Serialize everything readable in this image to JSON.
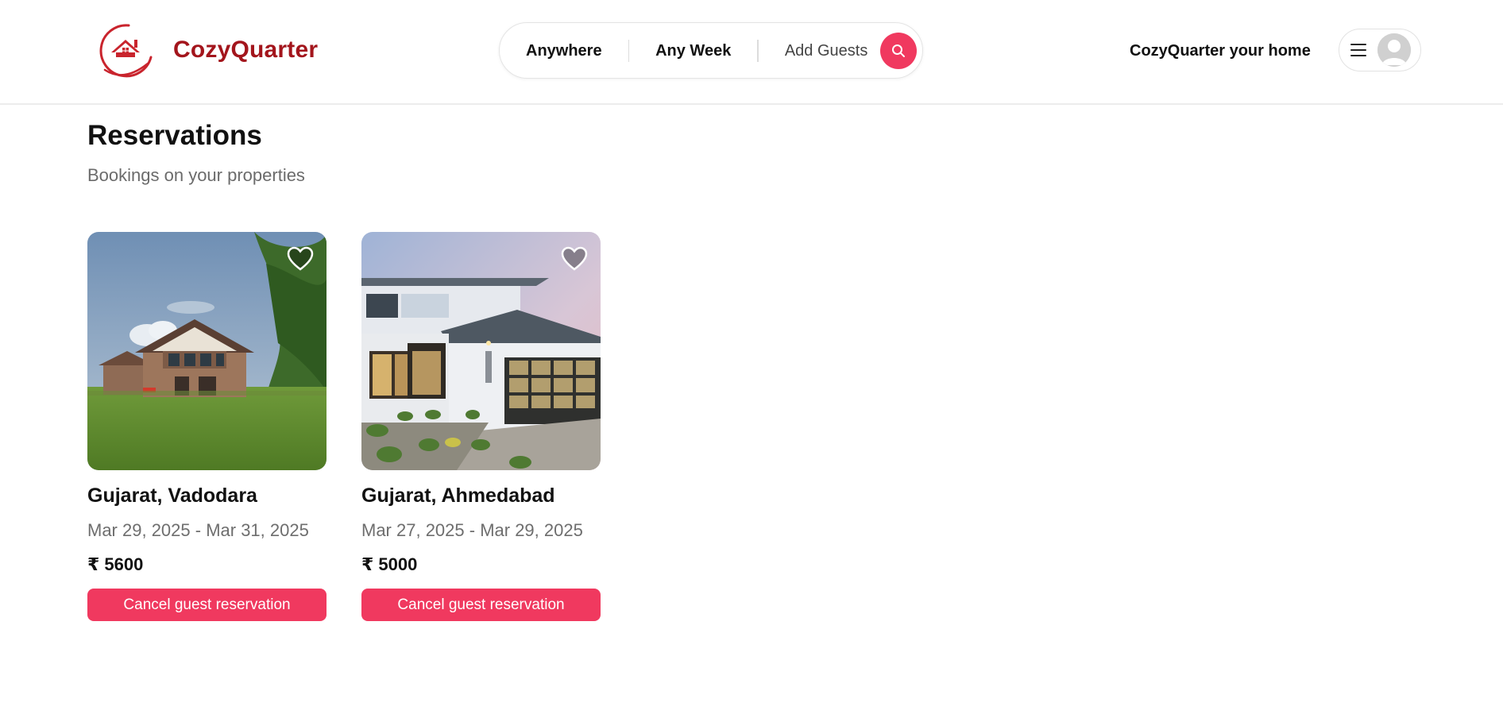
{
  "brand": {
    "name": "CozyQuarter",
    "color": "#a3151c"
  },
  "search": {
    "location_label": "Anywhere",
    "week_label": "Any Week",
    "guests_label": "Add Guests",
    "button_icon": "search-icon",
    "accent": "#f0395f"
  },
  "nav": {
    "host_link": "CozyQuarter your home",
    "menu_icon": "hamburger-icon",
    "avatar_icon": "user-avatar-icon"
  },
  "page": {
    "title": "Reservations",
    "subtitle": "Bookings on your properties"
  },
  "reservations": [
    {
      "location": "Gujarat, Vadodara",
      "dates": "Mar 29, 2025 - Mar 31, 2025",
      "price": "₹ 5600",
      "action": "Cancel guest reservation",
      "image": "country-house-photo"
    },
    {
      "location": "Gujarat, Ahmedabad",
      "dates": "Mar 27, 2025 - Mar 29, 2025",
      "price": "₹ 5000",
      "action": "Cancel guest reservation",
      "image": "modern-house-photo"
    }
  ]
}
